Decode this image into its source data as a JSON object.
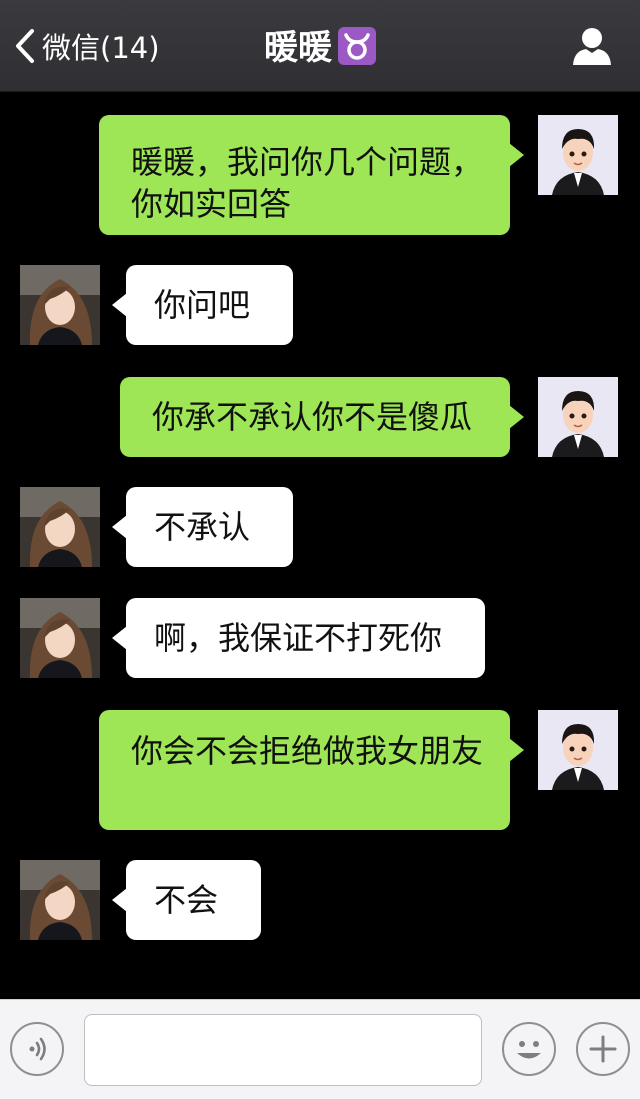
{
  "header": {
    "back_label": "微信(14)",
    "title": "暖暖",
    "zodiac_symbol": "♉",
    "zodiac_color": "#9b59c6"
  },
  "messages": [
    {
      "from": "me",
      "text_line1": "暖暖，我问你几个问题，",
      "text_line2": "你如实回答"
    },
    {
      "from": "her",
      "text": "你问吧"
    },
    {
      "from": "me",
      "text": "你承不承认你不是傻瓜"
    },
    {
      "from": "her",
      "text": "不承认"
    },
    {
      "from": "her",
      "text": "啊，我保证不打死你"
    },
    {
      "from": "me",
      "text": "你会不会拒绝做我女朋友"
    },
    {
      "from": "her",
      "text": "不会"
    }
  ],
  "input_bar": {
    "voice_icon": "voice-icon",
    "emoji_icon": "emoji-icon",
    "plus_icon": "plus-icon",
    "message_value": ""
  },
  "colors": {
    "header_bg": "#353539",
    "chat_bg": "#000000",
    "my_bubble": "#9ee656",
    "her_bubble": "#ffffff"
  }
}
